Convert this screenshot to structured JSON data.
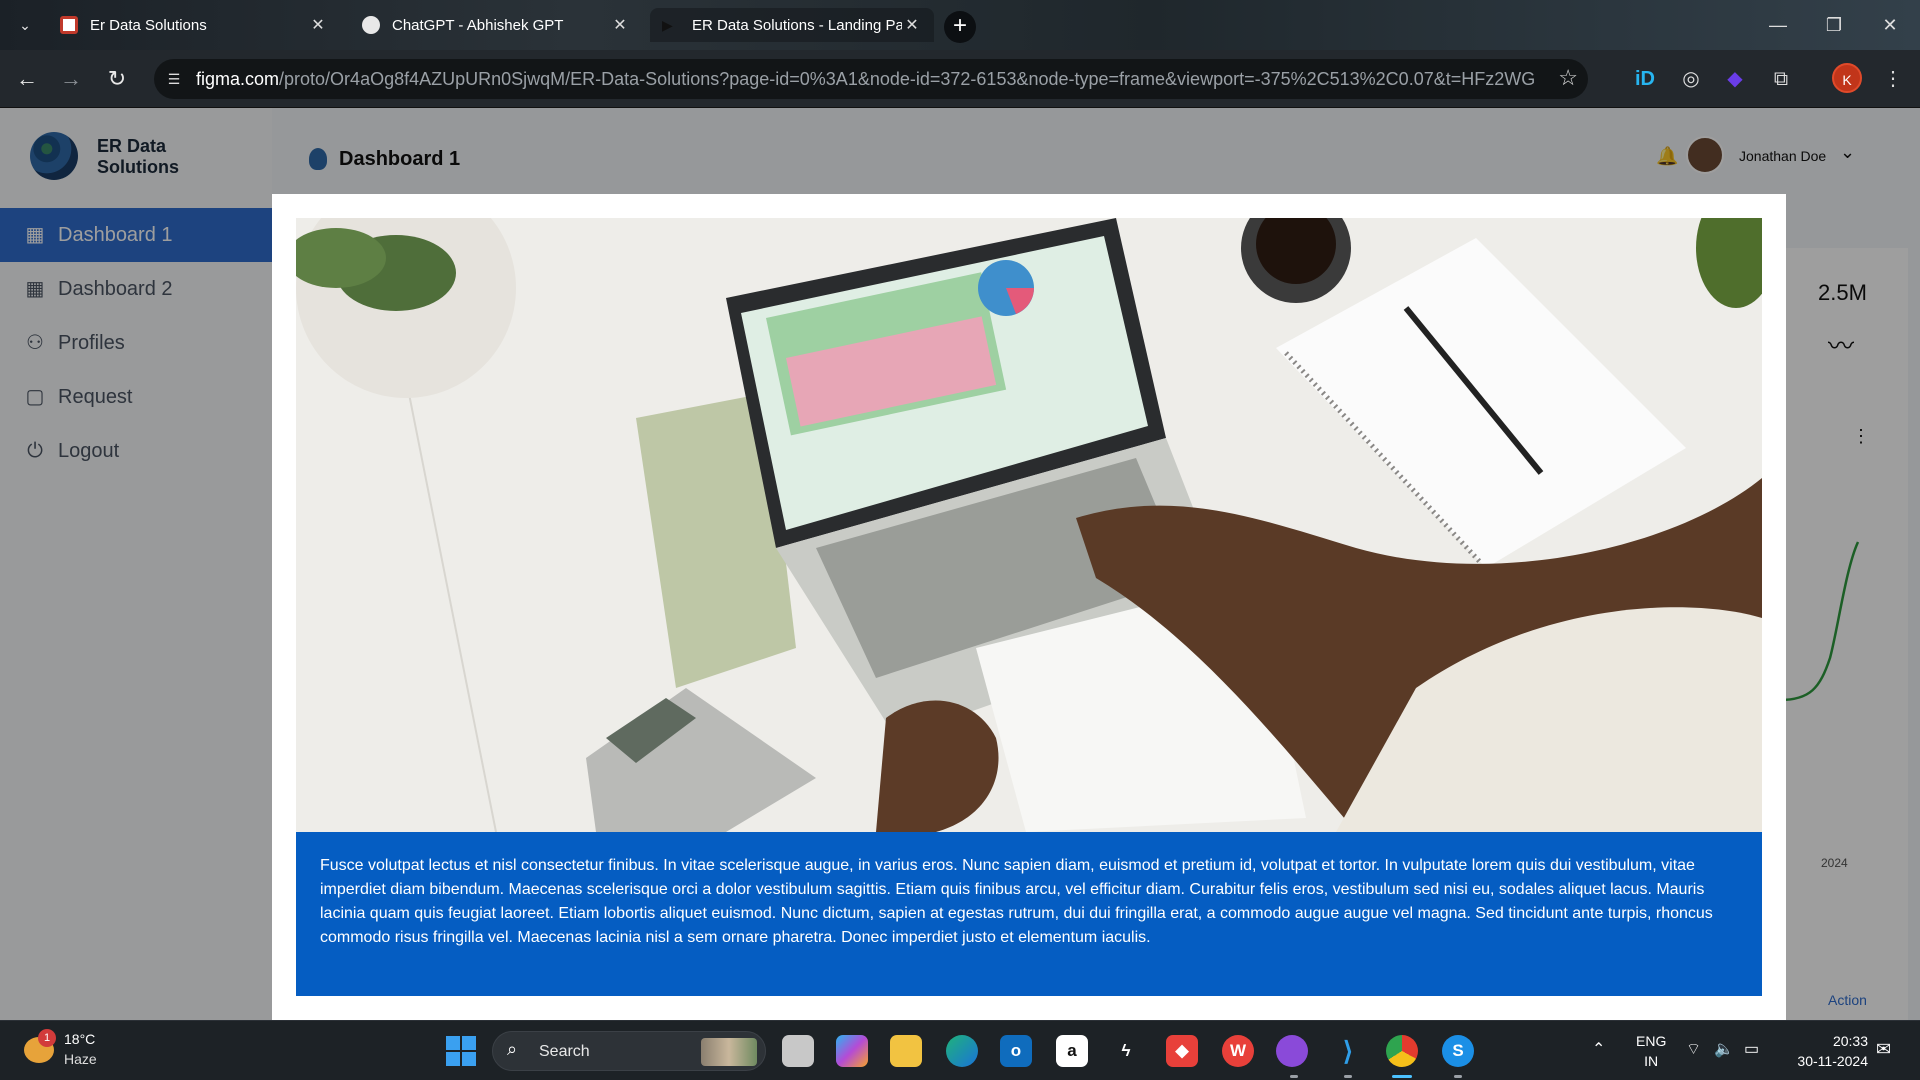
{
  "browser": {
    "tabs": [
      {
        "title": "Er Data Solutions",
        "active": false
      },
      {
        "title": "ChatGPT - Abhishek GPT",
        "active": false
      },
      {
        "title": "ER Data Solutions - Landing Pa",
        "active": true
      }
    ],
    "url_domain": "figma.com",
    "url_path": "/proto/Or4aOg8f4AZUpURn0SjwqM/ER-Data-Solutions?page-id=0%3A1&node-id=372-6153&node-type=frame&viewport=-375%2C513%2C0.07&t=HFz2WGoHx...",
    "profile_initial": "K"
  },
  "app": {
    "brand": {
      "line1": "ER Data",
      "line2": "Solutions"
    },
    "nav": [
      {
        "label": "Dashboard 1",
        "icon": "grid-icon",
        "active": true
      },
      {
        "label": "Dashboard 2",
        "icon": "grid-icon",
        "active": false
      },
      {
        "label": "Profiles",
        "icon": "people-icon",
        "active": false
      },
      {
        "label": "Request",
        "icon": "request-icon",
        "active": false
      },
      {
        "label": "Logout",
        "icon": "logout-icon",
        "active": false
      }
    ],
    "page_title": "Dashboard 1",
    "user_name": "Jonathan Doe",
    "background": {
      "stat_value": "2.5M",
      "axis_year": "2024",
      "action_label": "Action"
    }
  },
  "modal": {
    "image_alt": "Person working on a laptop with a spreadsheet dashboard, calculator and notebook on a white desk",
    "caption": "Fusce volutpat lectus et nisl consectetur finibus. In vitae scelerisque augue, in varius eros. Nunc sapien diam, euismod et pretium id, volutpat et tortor. In vulputate lorem quis dui vestibulum, vitae imperdiet diam bibendum. Maecenas scelerisque orci a dolor vestibulum sagittis. Etiam quis finibus arcu, vel efficitur diam. Curabitur felis eros, vestibulum sed nisi eu, sodales aliquet lacus. Mauris lacinia quam quis feugiat laoreet. Etiam lobortis aliquet euismod. Nunc dictum, sapien at egestas rutrum, dui dui fringilla erat, a commodo augue augue vel magna. Sed tincidunt ante turpis, rhoncus commodo risus fringilla vel. Maecenas lacinia nisl a sem ornare pharetra. Donec imperdiet justo et elementum iaculis."
  },
  "taskbar": {
    "weather_badge": "1",
    "temperature": "18°C",
    "condition": "Haze",
    "search_label": "Search",
    "lang_line1": "ENG",
    "lang_line2": "IN",
    "time": "20:33",
    "date": "30-11-2024",
    "apps": [
      "task-view",
      "copilot",
      "file-explorer",
      "edge",
      "outlook",
      "amazon",
      "git-tool",
      "anydesk",
      "wps",
      "github",
      "vscode",
      "chrome",
      "skype"
    ]
  },
  "colors": {
    "accent": "#2f6ccd",
    "caption_bg": "#055dc2",
    "profile_avatar": "#c1351a"
  }
}
